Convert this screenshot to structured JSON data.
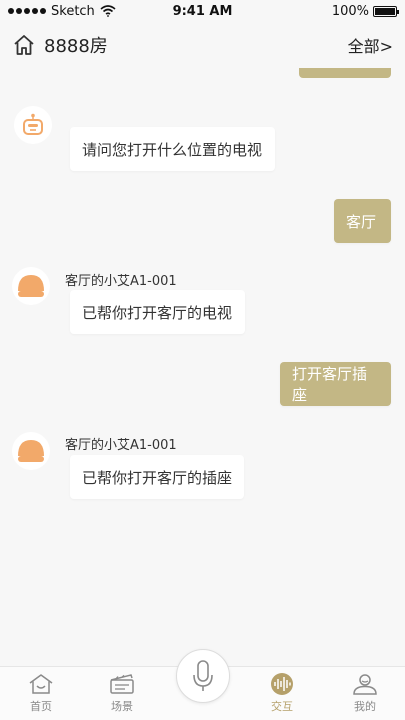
{
  "status_bar": {
    "carrier": "Sketch",
    "time": "9:41 AM",
    "battery": "100%"
  },
  "header": {
    "title": "8888房",
    "right_label": "全部>"
  },
  "messages": [
    {
      "from": "bot",
      "sender": "",
      "text": "请问您打开什么位置的电视"
    },
    {
      "from": "me",
      "text": "客厅"
    },
    {
      "from": "device",
      "sender": "客厅的小艾A1-001",
      "text": "已帮你打开客厅的电视"
    },
    {
      "from": "me",
      "text": "打开客厅插座"
    },
    {
      "from": "device",
      "sender": "客厅的小艾A1-001",
      "text": "已帮你打开客厅的插座"
    }
  ],
  "tabbar": {
    "items": [
      {
        "label": "首页",
        "icon": "home-icon"
      },
      {
        "label": "场景",
        "icon": "scene-icon"
      },
      {
        "label": "",
        "icon": "mic-icon"
      },
      {
        "label": "交互",
        "icon": "interaction-icon"
      },
      {
        "label": "我的",
        "icon": "profile-icon"
      }
    ],
    "active_index": 3
  },
  "colors": {
    "accent": "#c3b785",
    "avatar_orange": "#f2a96a",
    "active_tab": "#b5a06a"
  }
}
